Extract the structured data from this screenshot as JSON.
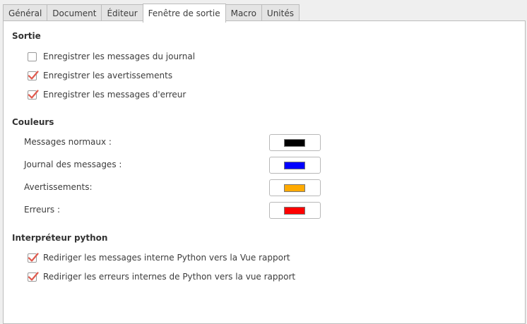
{
  "tabs": [
    {
      "label": "Général",
      "active": false
    },
    {
      "label": "Document",
      "active": false
    },
    {
      "label": "Éditeur",
      "active": false
    },
    {
      "label": "Fenêtre de sortie",
      "active": true
    },
    {
      "label": "Macro",
      "active": false
    },
    {
      "label": "Unités",
      "active": false
    }
  ],
  "output": {
    "title": "Sortie",
    "options": [
      {
        "label": "Enregistrer les messages du journal",
        "checked": false
      },
      {
        "label": "Enregistrer les avertissements",
        "checked": true
      },
      {
        "label": "Enregistrer les messages d'erreur",
        "checked": true
      }
    ]
  },
  "colors": {
    "title": "Couleurs",
    "items": [
      {
        "label": "Messages normaux :",
        "color": "#000000"
      },
      {
        "label": "Journal des messages :",
        "color": "#0000ff"
      },
      {
        "label": "Avertissements:",
        "color": "#ffaa00"
      },
      {
        "label": "Erreurs :",
        "color": "#ff0000"
      }
    ]
  },
  "python": {
    "title": "Interpréteur python",
    "options": [
      {
        "label": "Rediriger les messages interne Python vers la Vue rapport",
        "checked": true
      },
      {
        "label": "Rediriger les erreurs internes de Python vers la vue rapport",
        "checked": true
      }
    ]
  },
  "theme": {
    "check_color": "#e05a4e"
  }
}
